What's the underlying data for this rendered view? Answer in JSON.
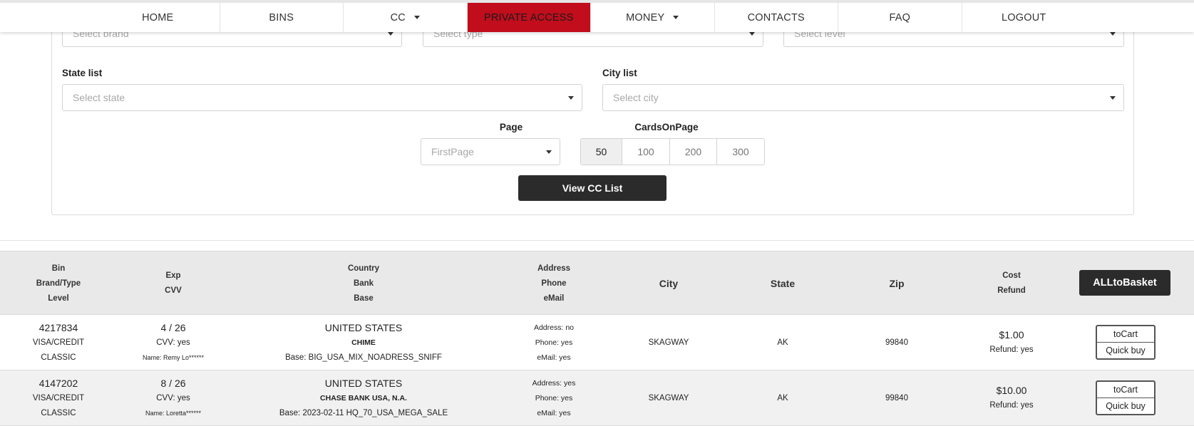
{
  "nav": {
    "items": [
      {
        "label": "HOME",
        "dropdown": false,
        "active": false
      },
      {
        "label": "BINS",
        "dropdown": false,
        "active": false
      },
      {
        "label": "CC",
        "dropdown": true,
        "active": false
      },
      {
        "label": "PRIVATE ACCESS",
        "dropdown": false,
        "active": true
      },
      {
        "label": "MONEY",
        "dropdown": true,
        "active": false
      },
      {
        "label": "CONTACTS",
        "dropdown": false,
        "active": false
      },
      {
        "label": "FAQ",
        "dropdown": false,
        "active": false
      },
      {
        "label": "LOGOUT",
        "dropdown": false,
        "active": false
      }
    ],
    "active_color": "#c10d1c"
  },
  "filters": {
    "brand_placeholder": "Select brand",
    "type_placeholder": "Select type",
    "level_placeholder": "Select level",
    "state_label": "State list",
    "state_placeholder": "Select state",
    "city_label": "City list",
    "city_placeholder": "Select city",
    "page_label": "Page",
    "page_value": "FirstPage",
    "cards_label": "CardsOnPage",
    "cards_options": [
      "50",
      "100",
      "200",
      "300"
    ],
    "cards_selected": "50",
    "view_button": "View CC List"
  },
  "table": {
    "headers": {
      "bin": [
        "Bin",
        "Brand/Type",
        "Level"
      ],
      "exp": [
        "Exp",
        "CVV"
      ],
      "country": [
        "Country",
        "Bank",
        "Base"
      ],
      "address": [
        "Address",
        "Phone",
        "eMail"
      ],
      "city": "City",
      "state": "State",
      "zip": "Zip",
      "cost": [
        "Cost",
        "Refund"
      ],
      "all_button": "ALLtoBasket"
    },
    "rows": [
      {
        "bin": "4217834",
        "brand": "VISA/CREDIT",
        "level": "CLASSIC",
        "exp": "4 / 26",
        "cvv": "CVV: yes",
        "name": "Name: Remy Lo******",
        "country": "UNITED STATES",
        "bank": "CHIME",
        "base": "Base: BIG_USA_MIX_NOADRESS_SNIFF",
        "address": "Address: no",
        "phone": "Phone: yes",
        "email": "eMail: yes",
        "city": "SKAGWAY",
        "state": "AK",
        "zip": "99840",
        "cost": "$1.00",
        "refund": "Refund: yes",
        "to_cart": "toCart",
        "quick_buy": "Quick buy"
      },
      {
        "bin": "4147202",
        "brand": "VISA/CREDIT",
        "level": "CLASSIC",
        "exp": "8 / 26",
        "cvv": "CVV: yes",
        "name": "Name: Loretta******",
        "country": "UNITED STATES",
        "bank": "CHASE BANK USA, N.A.",
        "base": "Base: 2023-02-11 HQ_70_USA_MEGA_SALE",
        "address": "Address: yes",
        "phone": "Phone: yes",
        "email": "eMail: yes",
        "city": "SKAGWAY",
        "state": "AK",
        "zip": "99840",
        "cost": "$10.00",
        "refund": "Refund: yes",
        "to_cart": "toCart",
        "quick_buy": "Quick buy"
      }
    ]
  }
}
